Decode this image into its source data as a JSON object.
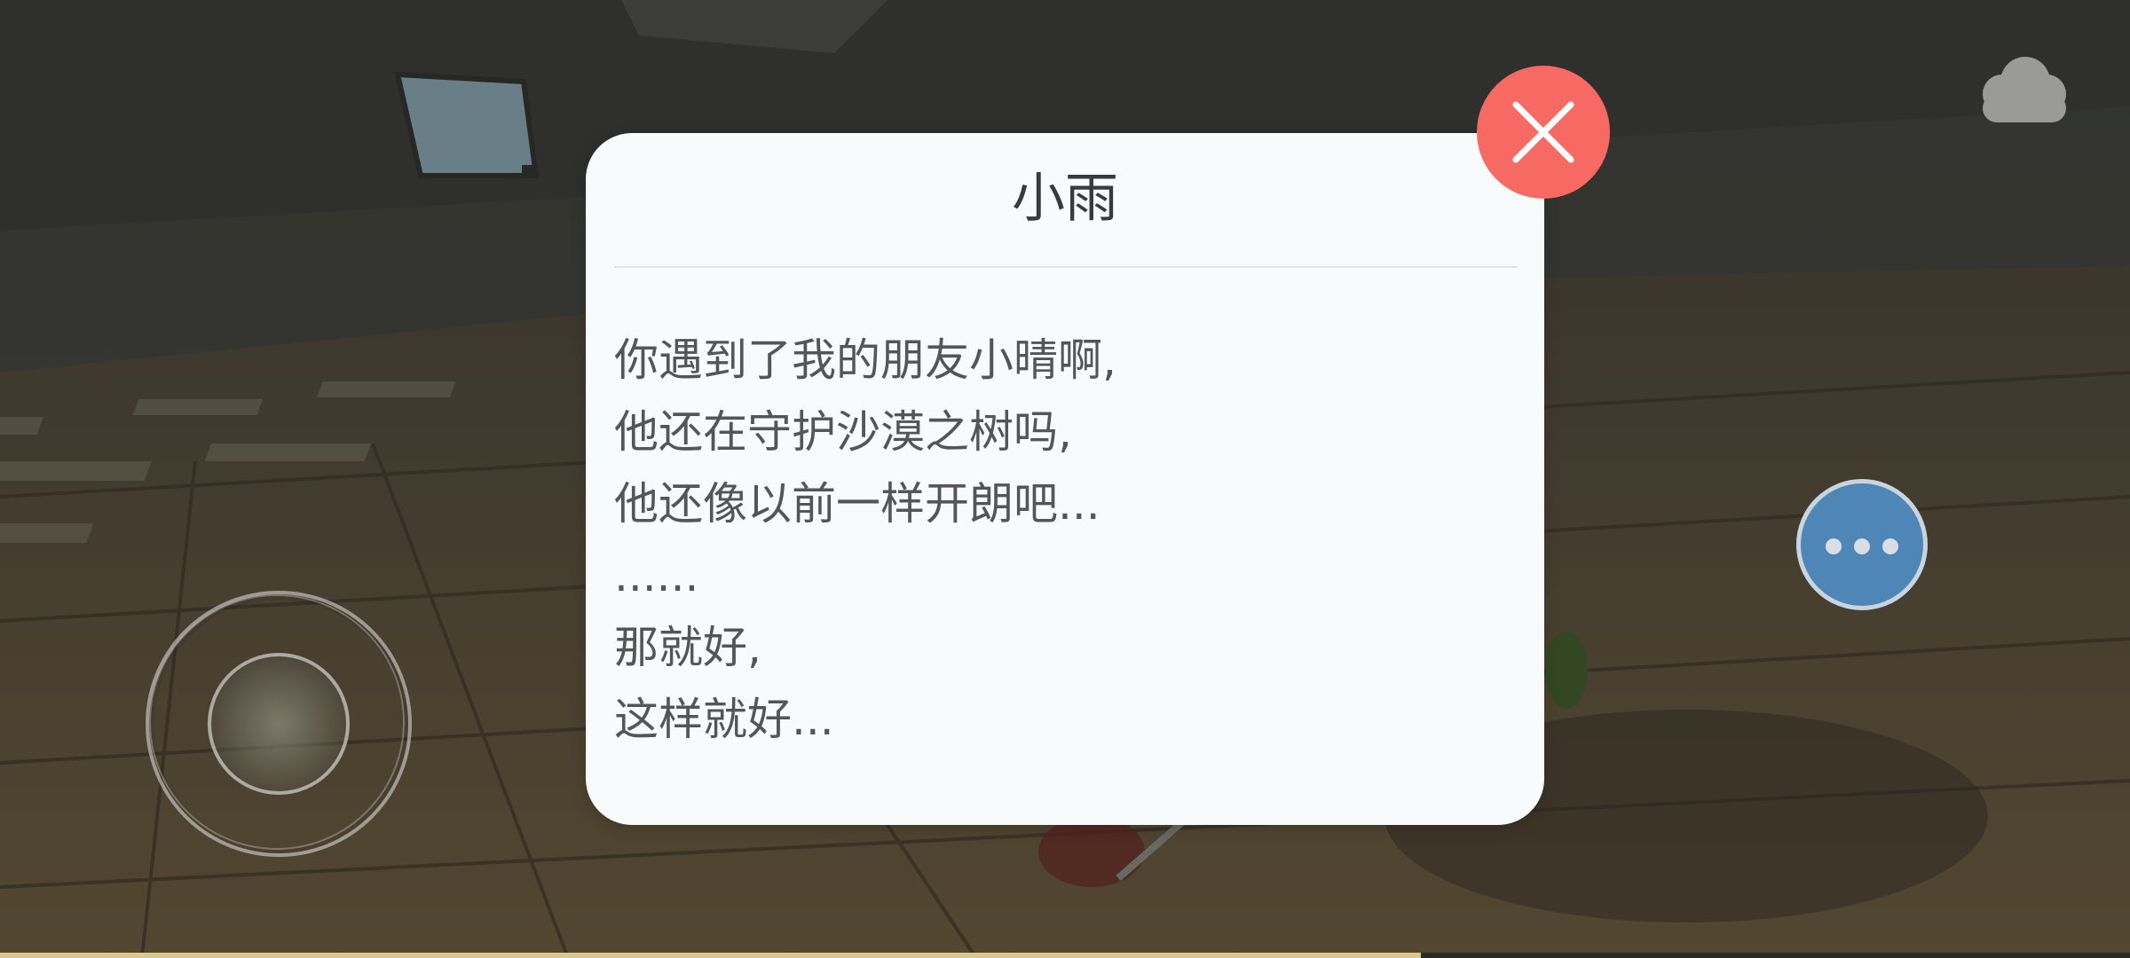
{
  "scene": {
    "description_icon": "wooden-cabin-interior"
  },
  "hud": {
    "cloud_icon": "cloud-icon",
    "more_icon": "ellipsis-icon",
    "joystick_icon": "virtual-joystick"
  },
  "dialog": {
    "speaker": "小雨",
    "lines": [
      "你遇到了我的朋友小晴啊,",
      "他还在守护沙漠之树吗,",
      "他还像以前一样开朗吧...",
      "......",
      "那就好,",
      "这样就好..."
    ],
    "close_icon": "close-icon"
  },
  "progress": {
    "fraction": 0.667
  },
  "colors": {
    "dialog_bg": "#f8fbfc",
    "close_button": "#f66a63",
    "more_button": "#4f86b8",
    "progress_fill": "#d9c98a"
  }
}
